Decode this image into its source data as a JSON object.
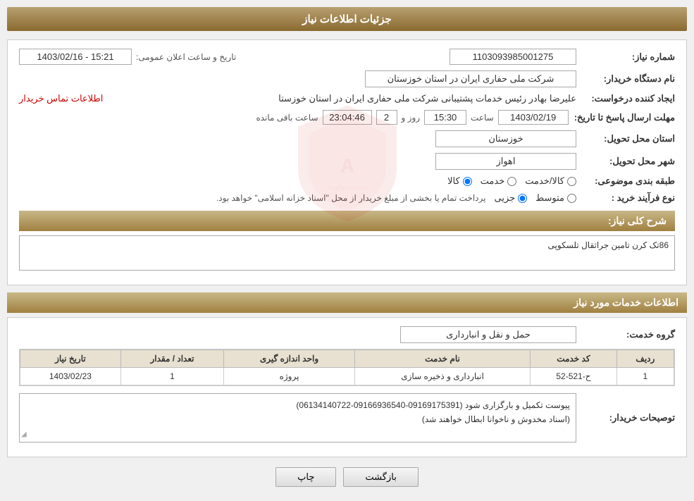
{
  "page": {
    "title": "جزئیات اطلاعات نیاز"
  },
  "header": {
    "need_number_label": "شماره نیاز:",
    "need_number_value": "1103093985001275",
    "announce_label": "تاریخ و ساعت اعلان عمومی:",
    "announce_value": "1403/02/16 - 15:21",
    "buyer_label": "نام دستگاه خریدار:",
    "buyer_value": "شرکت ملی حفاری ایران در استان خوزستان",
    "creator_label": "ایجاد کننده درخواست:",
    "creator_value": "علیرضا بهادر رئیس خدمات پشتیبانی شرکت ملی حفاری ایران در استان خوزستا",
    "contact_link": "اطلاعات تماس خریدار",
    "deadline_label": "مهلت ارسال پاسخ تا تاریخ:",
    "deadline_date": "1403/02/19",
    "deadline_time_label": "ساعت",
    "deadline_time": "15:30",
    "deadline_day_label": "روز و",
    "deadline_days": "2",
    "deadline_remaining_label": "ساعت باقی مانده",
    "deadline_remaining": "23:04:46",
    "province_label": "استان محل تحویل:",
    "province_value": "خوزستان",
    "city_label": "شهر محل تحویل:",
    "city_value": "اهواز",
    "category_label": "طبقه بندی موضوعی:",
    "category_options": [
      "کالا",
      "خدمت",
      "کالا/خدمت"
    ],
    "category_selected": "کالا",
    "purchase_type_label": "نوع فرآیند خرید :",
    "purchase_options": [
      "جزیی",
      "متوسط"
    ],
    "purchase_note": "پرداخت تمام یا بخشی از مبلغ خریدار از محل \"اسناد خزانه اسلامی\" خواهد بود.",
    "need_description_label": "شرح کلی نیاز:",
    "need_description": "86تک کرن تامین جراثقال تلسکوپی"
  },
  "services_section": {
    "title": "اطلاعات خدمات مورد نیاز",
    "service_group_label": "گروه خدمت:",
    "service_group_value": "حمل و نقل و انبارداری",
    "table": {
      "headers": [
        "ردیف",
        "کد خدمت",
        "نام خدمت",
        "واحد اندازه گیری",
        "تعداد / مقدار",
        "تاریخ نیاز"
      ],
      "rows": [
        {
          "row": "1",
          "code": "ح-521-52",
          "name": "انبارداری و ذخیره سازی",
          "unit": "پروژه",
          "quantity": "1",
          "date": "1403/02/23"
        }
      ]
    }
  },
  "buyer_description_label": "توصیحات خریدار:",
  "buyer_description": "پیوست تکمیل و بارگزاری شود (09169175391-09166936540-06134140722)\n(اسناد مخدوش و ناخوانا ابطال خواهند شد)",
  "buttons": {
    "print": "چاپ",
    "back": "بازگشت"
  }
}
